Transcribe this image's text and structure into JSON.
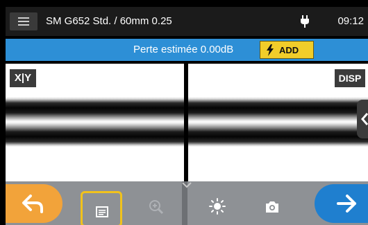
{
  "statusbar": {
    "title": "SM G652 Std. / 60mm 0.25",
    "time": "09:12",
    "menu_icon": "hamburger-menu-icon",
    "power_icon": "power-plug-icon"
  },
  "infobar": {
    "loss_text": "Perte estimée 0.00dB",
    "add_label": "ADD",
    "add_icon": "lightning-bolt-icon",
    "bar_color": "#2d8fd6",
    "add_color": "#f1cd2a"
  },
  "camera": {
    "xy_label": "X|Y",
    "disp_label": "DISP",
    "side_tab_icon": "chevron-left-icon"
  },
  "toolbar": {
    "back_icon": "return-arrow-icon",
    "back_color": "#f2a33a",
    "list_icon": "list-document-icon",
    "zoom_icon": "zoom-in-icon",
    "expand_icon": "chevron-down-icon",
    "brightness_icon": "brightness-icon",
    "camera_icon": "camera-icon",
    "next_icon": "arrow-right-icon",
    "next_color": "#1f7fcf"
  }
}
